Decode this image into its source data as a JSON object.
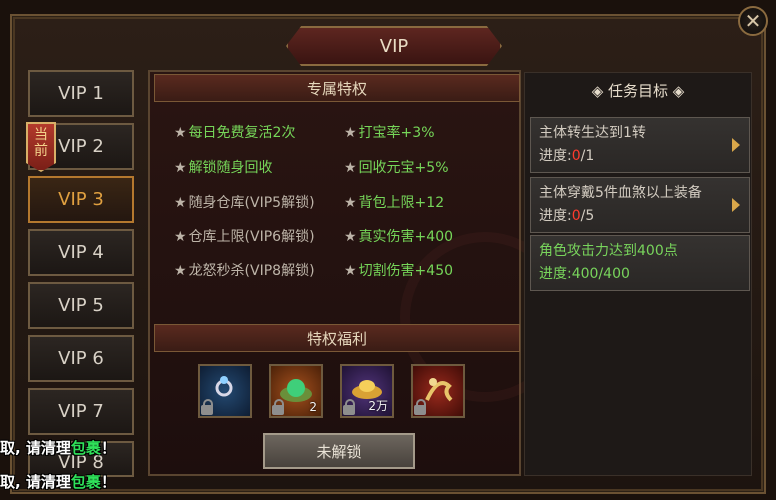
{
  "window": {
    "title": "VIP",
    "close_symbol": "✕"
  },
  "tabs": [
    {
      "label": "VIP 1",
      "state": "normal"
    },
    {
      "label": "VIP 2",
      "state": "current"
    },
    {
      "label": "VIP 3",
      "state": "selected"
    },
    {
      "label": "VIP 4",
      "state": "normal"
    },
    {
      "label": "VIP 5",
      "state": "normal"
    },
    {
      "label": "VIP 6",
      "state": "normal"
    },
    {
      "label": "VIP 7",
      "state": "normal"
    },
    {
      "label": "VIP 8",
      "state": "normal"
    }
  ],
  "current_badge": {
    "text": "当\n前"
  },
  "privileges": {
    "title": "专属特权",
    "left": [
      {
        "text": "每日免费复活2次",
        "unlocked": true
      },
      {
        "text": "解锁随身回收",
        "unlocked": true
      },
      {
        "text": "随身仓库(VIP5解锁)",
        "unlocked": false
      },
      {
        "text": "仓库上限(VIP6解锁)",
        "unlocked": false
      },
      {
        "text": "龙怒秒杀(VIP8解锁)",
        "unlocked": false
      }
    ],
    "right": [
      {
        "text": "打宝率+3%",
        "unlocked": true
      },
      {
        "text": "回收元宝+5%",
        "unlocked": true
      },
      {
        "text": "背包上限+12",
        "unlocked": true
      },
      {
        "text": "真实伤害+400",
        "unlocked": true
      },
      {
        "text": "切割伤害+450",
        "unlocked": true
      }
    ],
    "star": "★"
  },
  "benefits": {
    "title": "特权福利",
    "items": [
      {
        "icon": "gem-ring-icon",
        "quality": "blue",
        "qty": ""
      },
      {
        "icon": "jade-orb-icon",
        "quality": "orange",
        "qty": "2"
      },
      {
        "icon": "gold-ingot-icon",
        "quality": "purple",
        "qty": "2万"
      },
      {
        "icon": "dragon-relic-icon",
        "quality": "red",
        "qty": ""
      }
    ],
    "button_label": "未解锁"
  },
  "tasks": {
    "title": "◈ 任务目标 ◈",
    "items": [
      {
        "text": "主体转生达到1转",
        "progress_label": "进度:",
        "progress_current": "0",
        "progress_total": "/1",
        "done": false
      },
      {
        "text": "主体穿戴5件血煞以上装备",
        "progress_label": "进度:",
        "progress_current": "0",
        "progress_total": "/5",
        "done": false
      },
      {
        "text": "角色攻击力达到400点",
        "progress_label": "进度:",
        "progress_current": "400",
        "progress_total": "/400",
        "done": true
      }
    ]
  },
  "toasts": [
    {
      "prefix": "取, 请清理",
      "highlight": "包裹",
      "suffix": "！"
    },
    {
      "prefix": "取, 请清理",
      "highlight": "包裹",
      "suffix": "！"
    }
  ]
}
